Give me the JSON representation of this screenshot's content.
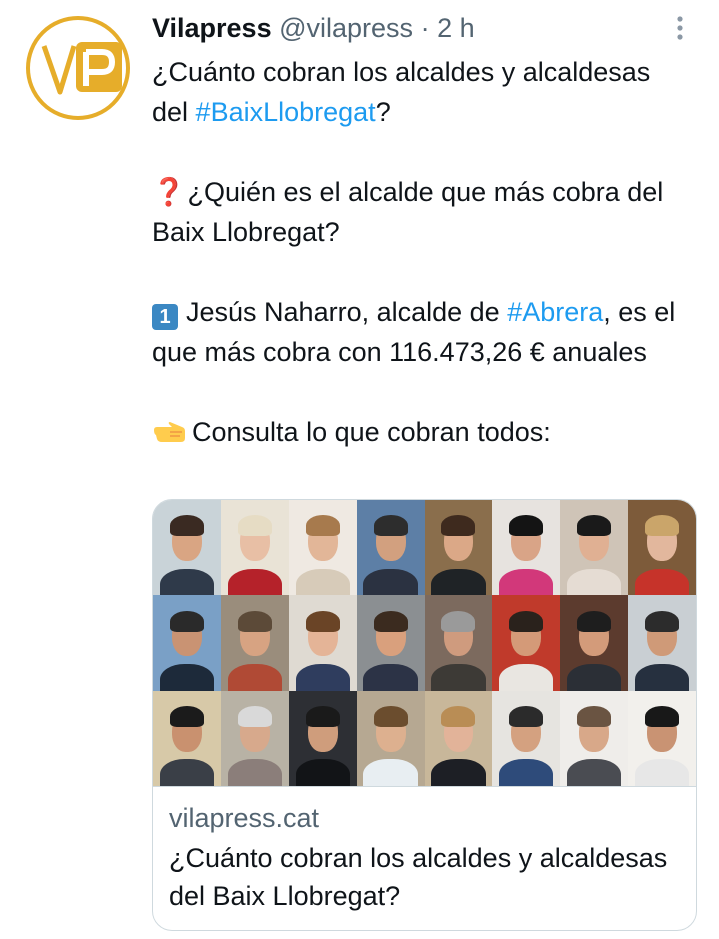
{
  "account": {
    "name": "Vilapress",
    "handle": "@vilapress",
    "separator": "·",
    "time": "2 h",
    "avatar_text": "VP",
    "avatar_color": "#e6ad2a"
  },
  "tweet": {
    "line1_a": "¿Cuánto cobran los alcaldes y alcaldesas del ",
    "line1_hashtag": "#BaixLlobregat",
    "line1_b": "?",
    "q_emoji": "❓",
    "q_text": " ¿Quién es el alcalde que más cobra del Baix Llobregat?",
    "keycap": "1",
    "a_text_a": "Jesús Naharro, alcalde de ",
    "a_hashtag": "#Abrera",
    "a_text_b": ", es el que más cobra con 116.473,26 € anuales",
    "consult_text": "Consulta lo que cobran todos:",
    "hashtag_color": "#1d9bf0"
  },
  "card": {
    "domain": "vilapress.cat",
    "title": "¿Cuánto cobran los alcaldes y alcaldesas del Baix Llobregat?",
    "image_alt": "Grid of 24 mayor portraits",
    "portraits": [
      {
        "bg": "#c9d3d8",
        "skin": "#d9a583",
        "hair": "#3a2a22",
        "cloth": "#2f3a4a"
      },
      {
        "bg": "#e9e3d6",
        "skin": "#e8bfa5",
        "hair": "#e6dcc4",
        "cloth": "#b5222a"
      },
      {
        "bg": "#efe9e2",
        "skin": "#e2b698",
        "hair": "#a77a4d",
        "cloth": "#d7cbb9"
      },
      {
        "bg": "#5d7fa6",
        "skin": "#d2a07f",
        "hair": "#2d2d2d",
        "cloth": "#2b3241"
      },
      {
        "bg": "#8a6e4c",
        "skin": "#dba887",
        "hair": "#3e2a1e",
        "cloth": "#1f2326"
      },
      {
        "bg": "#e7e3df",
        "skin": "#d9a487",
        "hair": "#141414",
        "cloth": "#d2387a"
      },
      {
        "bg": "#cfc4b7",
        "skin": "#e0b093",
        "hair": "#1a1a1a",
        "cloth": "#e5dcd3"
      },
      {
        "bg": "#7d5b3a",
        "skin": "#e2b79d",
        "hair": "#caa56a",
        "cloth": "#c6332a"
      },
      {
        "bg": "#7aa0c6",
        "skin": "#c99373",
        "hair": "#2a2a2a",
        "cloth": "#1d2a3a"
      },
      {
        "bg": "#9a8d7c",
        "skin": "#d7a382",
        "hair": "#5c4a38",
        "cloth": "#b04a35"
      },
      {
        "bg": "#dfdad2",
        "skin": "#e4b497",
        "hair": "#6a4426",
        "cloth": "#2f3d5e"
      },
      {
        "bg": "#8b8f92",
        "skin": "#d9a07d",
        "hair": "#3b2b1f",
        "cloth": "#2c3346"
      },
      {
        "bg": "#7c6a5e",
        "skin": "#cf9b7e",
        "hair": "#9a9a9a",
        "cloth": "#3d3a36"
      },
      {
        "bg": "#c03a2b",
        "skin": "#d49a78",
        "hair": "#2a221c",
        "cloth": "#e9e6e1"
      },
      {
        "bg": "#5c3b2e",
        "skin": "#d39b7a",
        "hair": "#1e1e1e",
        "cloth": "#2b2f36"
      },
      {
        "bg": "#c9cfd3",
        "skin": "#cf9a78",
        "hair": "#2c2c2c",
        "cloth": "#26303f"
      },
      {
        "bg": "#d7c9a8",
        "skin": "#c9916f",
        "hair": "#1b1b1b",
        "cloth": "#3a3f47"
      },
      {
        "bg": "#b8b2a5",
        "skin": "#d7a98c",
        "hair": "#d9d9d9",
        "cloth": "#8b7e7a"
      },
      {
        "bg": "#2d2f34",
        "skin": "#cf9d7c",
        "hair": "#1a1a1a",
        "cloth": "#121417"
      },
      {
        "bg": "#b6a892",
        "skin": "#ddb08f",
        "hair": "#6b4d2e",
        "cloth": "#e8eef2"
      },
      {
        "bg": "#c8b79a",
        "skin": "#e2b399",
        "hair": "#b98d55",
        "cloth": "#1d1f25"
      },
      {
        "bg": "#e6e4e0",
        "skin": "#d4a180",
        "hair": "#2b2b2b",
        "cloth": "#2e4b7a"
      },
      {
        "bg": "#efedea",
        "skin": "#d8a889",
        "hair": "#6a5442",
        "cloth": "#4a4c52"
      },
      {
        "bg": "#f2f0ec",
        "skin": "#c99373",
        "hair": "#181818",
        "cloth": "#e7e7e7"
      }
    ]
  }
}
